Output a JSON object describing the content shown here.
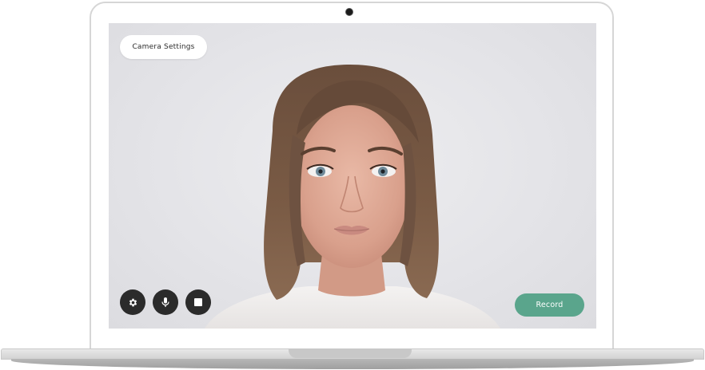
{
  "camera_settings": {
    "label": "Camera Settings"
  },
  "controls": {
    "settings_icon": "gear-icon",
    "mic_icon": "microphone-icon",
    "stop_icon": "stop-icon"
  },
  "record": {
    "label": "Record"
  },
  "colors": {
    "record_green": "#5aa58c",
    "control_dark": "#2b2b2b",
    "screen_bg": "#e4e4e8"
  }
}
